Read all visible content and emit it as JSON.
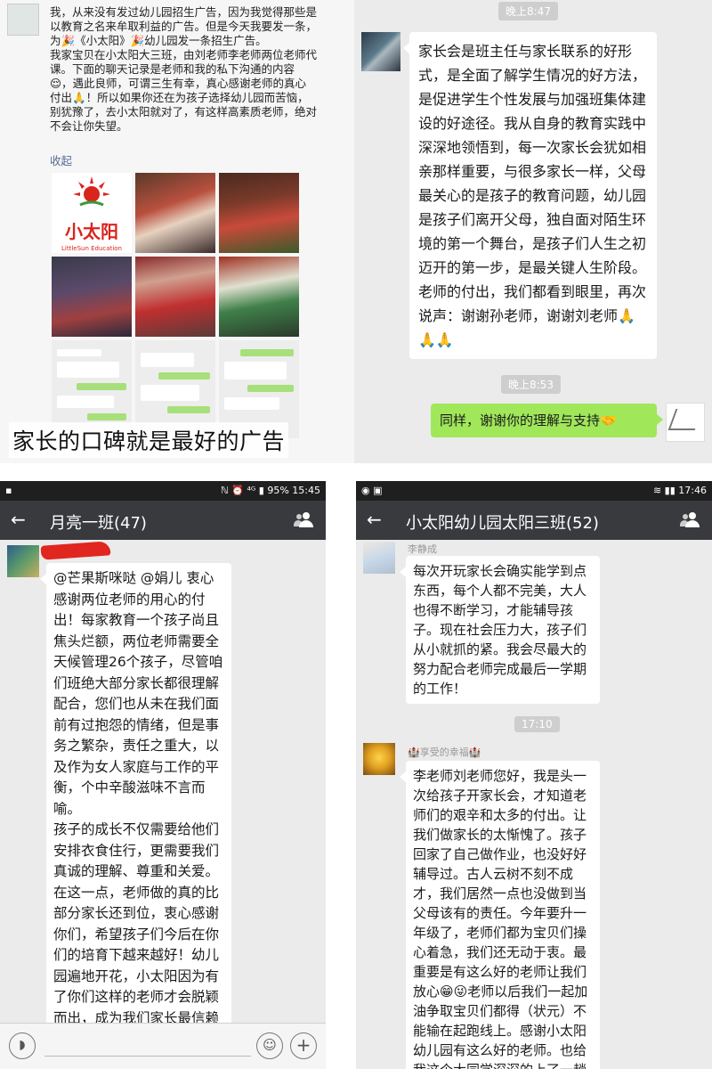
{
  "panel1": {
    "post_text": "我，从来没有发过幼儿园招生广告，因为我觉得那些是以教育之名来牟取利益的广告。但是今天我要发一条，为🎉《小太阳》🎉幼儿园发一条招生广告。\n我家宝贝在小太阳大三班，由刘老师李老师两位老师代课。下面的聊天记录是老师和我的私下沟通的内容😌，遇此良师，可谓三生有幸，真心感谢老师的真心付出🙏！所以如果你还在为孩子选择幼儿园而苦恼，别犹豫了，去小太阳就对了，有这样高素质老师，绝对不会让你失望。",
    "collapse_label": "收起",
    "logo_title": "小太阳",
    "logo_subtitle": "LittleSun Education",
    "banner": "家长的口碑就是最好的广告"
  },
  "panel2": {
    "time1": "晚上8:47",
    "message1": "家长会是班主任与家长联系的好形式，是全面了解学生情况的好方法，是促进学生个性发展与加强班集体建设的好途径。我从自身的教育实践中深深地领悟到，每一次家长会犹如相亲那样重要，与很多家长一样，父母最关心的是孩子的教育问题，幼儿园是孩子们离开父母，独自面对陌生环境的第一个舞台，是孩子们人生之初迈开的第一步，是最关键人生阶段。老师的付出，我们都看到眼里，再次说声：谢谢孙老师，谢谢刘老师🙏🙏🙏",
    "time2": "晚上8:53",
    "reply": "同样，谢谢你的理解与支持🤝"
  },
  "panel3": {
    "status_time": "15:45",
    "status_battery": "95%",
    "status_icons": "ℕ ⏰ ⁴ᴳ ▮",
    "chat_title": "月亮一班(47)",
    "message": "@芒果斯咪哒 @娟儿 衷心感谢两位老师的用心的付出！每家教育一个孩子尚且焦头烂额，两位老师需要全天候管理26个孩子，尽管咱们班绝大部分家长都很理解配合，您们也从未在我们面前有过抱怨的情绪，但是事务之繁杂，责任之重大，以及作为女人家庭与工作的平衡，个中辛酸滋味不言而喻。\n孩子的成长不仅需要给他们安排衣食住行，更需要我们真诚的理解、尊重和关爱。在这一点，老师做的真的比部分家长还到位，衷心感谢你们，希望孩子们今后在你们的培育下越来越好！幼儿园遍地开花，小太阳因为有了你们这样的老师才会脱颖而出，成为我们家长最信赖"
  },
  "panel4": {
    "status_time": "17:46",
    "status_icons": "◉ ▣",
    "chat_title": "小太阳幼儿园太阳三班(52)",
    "sender1": "李静成",
    "message1": "每次开玩家长会确实能学到点东西，每个人都不完美，大人也得不断学习，才能辅导孩子。现在社会压力大，孩子们从小就抓的紧。我会尽最大的努力配合老师完成最后一学期的工作！",
    "time": "17:10",
    "sender2": "🏰享受的幸福🏰",
    "message2": "李老师刘老师您好，我是头一次给孩子开家长会，才知道老师们的艰辛和太多的付出。让我们做家长的太惭愧了。孩子回家了自己做作业，也没好好辅导过。古人云树不刻不成才，我们居然一点也没做到当父母该有的责任。今年要升一年级了，老师们都为宝贝们操心着急，我们还无动于衷。最重要是有这么好的老师让我们放心😁😜老师以后我们一起加油争取宝贝们都得（状元）不能输在起跑线上。感谢小太阳幼儿园有这么好的老师。也给我这个大同学深深的上了一趟课😌"
  },
  "colors": {
    "wechat_bar": "#393a3e",
    "chat_bg": "#ebebeb",
    "green_bubble": "#a0e75a",
    "link_blue": "#576b95",
    "logo_red": "#d9251c"
  }
}
